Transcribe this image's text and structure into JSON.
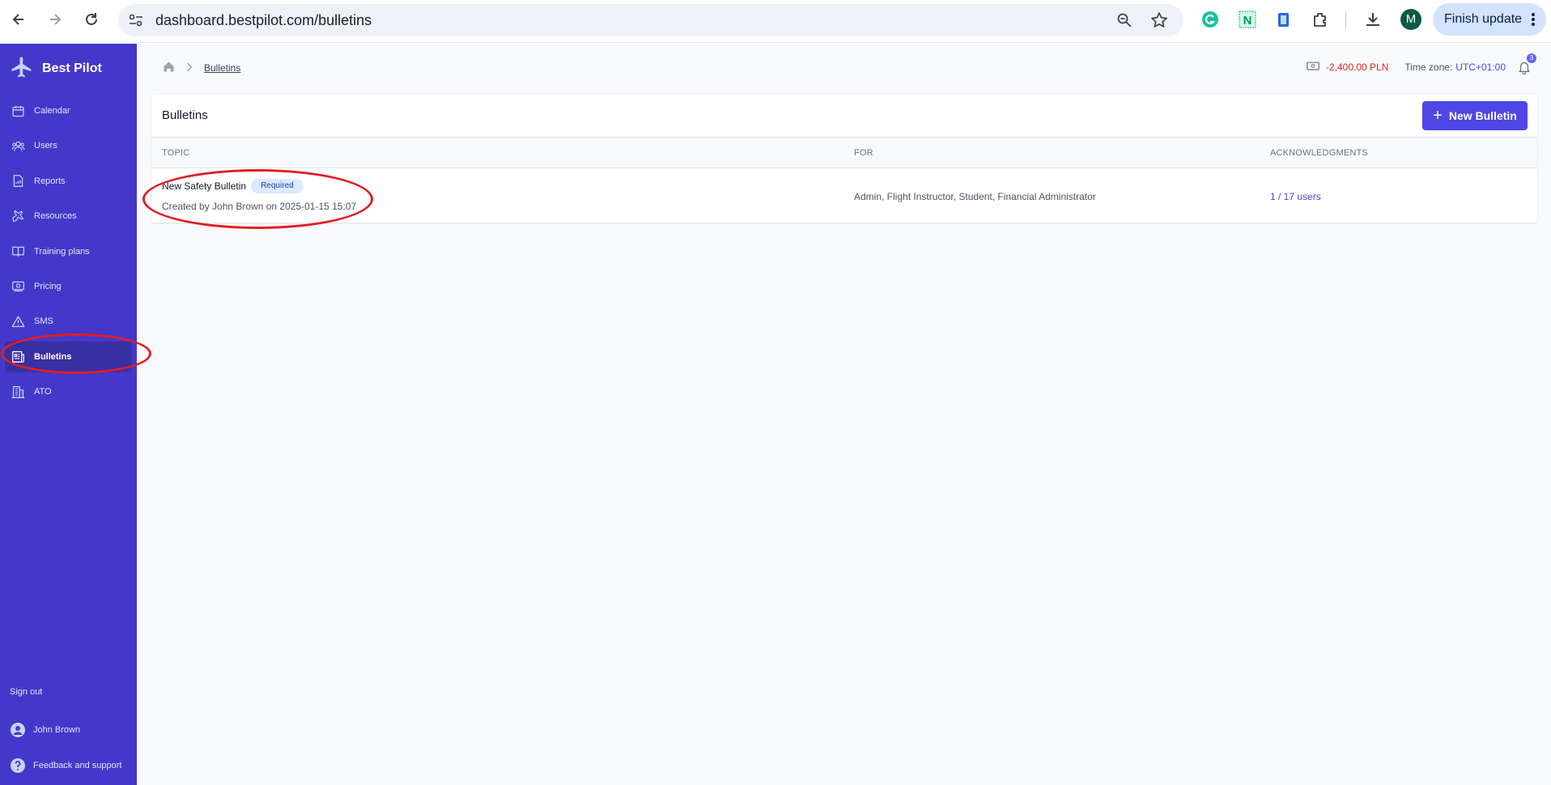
{
  "browser": {
    "url": "dashboard.bestpilot.com/bulletins",
    "profile_initial": "M",
    "finish_update_label": "Finish update"
  },
  "sidebar": {
    "brand": "Best Pilot",
    "items": [
      {
        "label": "Calendar",
        "icon": "calendar-icon"
      },
      {
        "label": "Users",
        "icon": "users-icon"
      },
      {
        "label": "Reports",
        "icon": "reports-icon"
      },
      {
        "label": "Resources",
        "icon": "plane-icon"
      },
      {
        "label": "Training plans",
        "icon": "book-icon"
      },
      {
        "label": "Pricing",
        "icon": "money-icon"
      },
      {
        "label": "SMS",
        "icon": "warning-icon"
      },
      {
        "label": "Bulletins",
        "icon": "newspaper-icon",
        "active": true
      },
      {
        "label": "ATO",
        "icon": "building-icon"
      }
    ],
    "sign_out": "Sign out",
    "user_name": "John Brown",
    "feedback": "Feedback and support"
  },
  "topbar": {
    "breadcrumb": "Bulletins",
    "balance": "-2,400.00 PLN",
    "timezone_label": "Time zone:",
    "timezone_value": "UTC+01:00",
    "notification_count": "3"
  },
  "bulletins": {
    "title": "Bulletins",
    "new_button": "New Bulletin",
    "columns": {
      "topic": "TOPIC",
      "for": "FOR",
      "acknowledgments": "ACKNOWLEDGMENTS"
    },
    "rows": [
      {
        "title": "New Safety Bulletin",
        "tag": "Required",
        "meta": "Created by John Brown on 2025-01-15 15:07",
        "for": "Admin, Flight Instructor, Student, Financial Administrator",
        "acknowledgments": "1 / 17 users"
      }
    ]
  },
  "colors": {
    "sidebar": "#4338ca",
    "sidebar_active": "#3730a3",
    "accent": "#4f46e5",
    "balance_negative": "#dc2626",
    "annotation": "#e11d23"
  }
}
